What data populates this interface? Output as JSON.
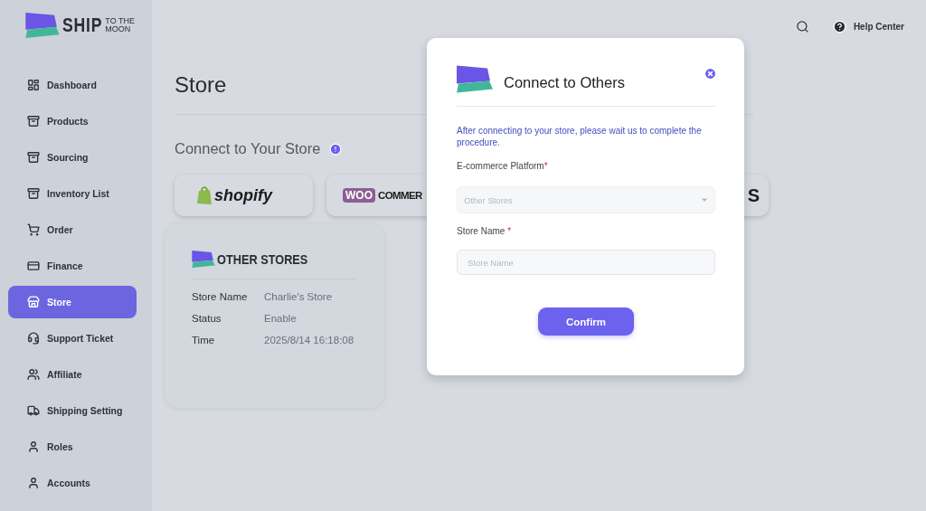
{
  "brand": {
    "name": "SHIP",
    "tagline_top": "TO THE",
    "tagline_bottom": "MOON"
  },
  "sidebar": {
    "items": [
      {
        "label": "Dashboard",
        "selected": false
      },
      {
        "label": "Products",
        "selected": false
      },
      {
        "label": "Sourcing",
        "selected": false
      },
      {
        "label": "Inventory List",
        "selected": false
      },
      {
        "label": "Order",
        "selected": false
      },
      {
        "label": "Finance",
        "selected": false
      },
      {
        "label": "Store",
        "selected": true
      },
      {
        "label": "Support Ticket",
        "selected": false
      },
      {
        "label": "Affiliate",
        "selected": false
      },
      {
        "label": "Shipping Setting",
        "selected": false
      },
      {
        "label": "Roles",
        "selected": false
      },
      {
        "label": "Accounts",
        "selected": false
      }
    ]
  },
  "topbar": {
    "help": "Help Center"
  },
  "page": {
    "title": "Store",
    "section_title": "Connect to Your Store",
    "platforms": [
      {
        "kind": "shopify",
        "label": "shopify"
      },
      {
        "kind": "woo",
        "badge": "WOO",
        "label": "COMMER"
      },
      {
        "kind": "partial",
        "label": "S"
      }
    ],
    "other_stores": {
      "logo_text": "OTHER STORES",
      "fields": [
        {
          "label": "Store Name",
          "value": "Charlie's Store"
        },
        {
          "label": "Status",
          "value": "Enable"
        },
        {
          "label": "Time",
          "value": "2025/8/14 16:18:08"
        }
      ]
    }
  },
  "dialog": {
    "title": "Connect to Others",
    "notice": "After connecting to your store, please wait us to complete the procedure.",
    "platform": {
      "label": "E-commerce Platform",
      "required_mark": "*",
      "value": "Other Stores",
      "disabled": true
    },
    "store_name": {
      "label": "Store Name",
      "required_mark": "*",
      "placeholder": "Store Name"
    },
    "confirm": "Confirm"
  }
}
